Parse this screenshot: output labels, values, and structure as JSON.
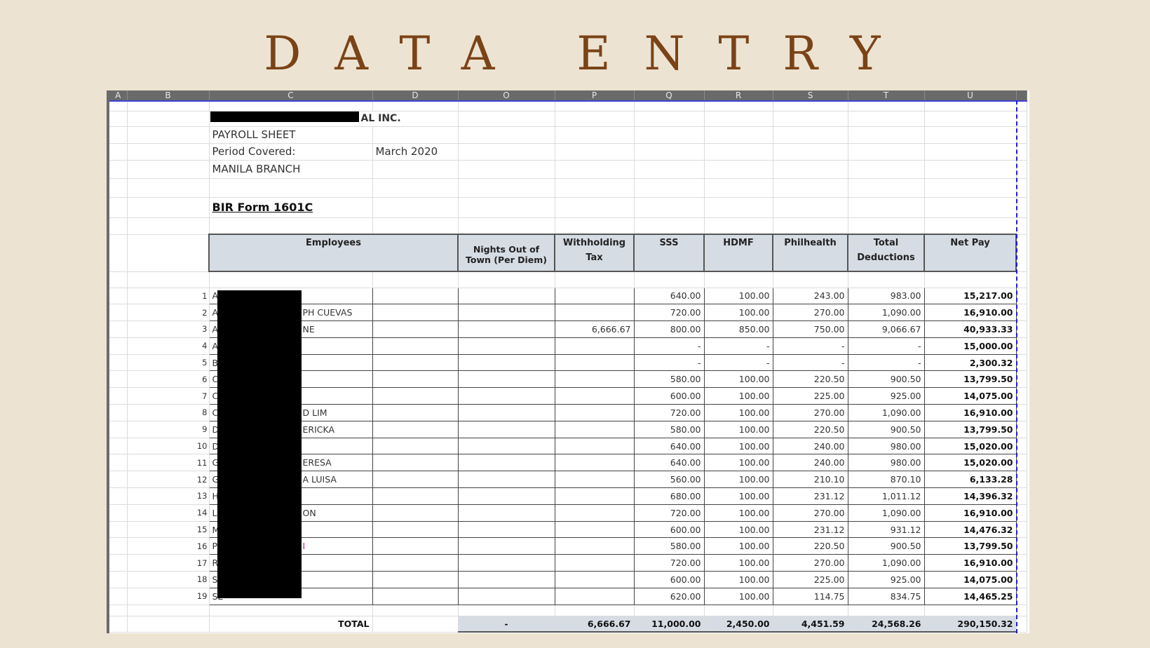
{
  "title": "DATA ENTRY",
  "columns": [
    "A",
    "B",
    "C",
    "D",
    "O",
    "P",
    "Q",
    "R",
    "S",
    "T",
    "U"
  ],
  "company_suffix": "AL INC.",
  "sheet_label": "PAYROLL SHEET",
  "period_label": "Period Covered:",
  "period_value": "March 2020",
  "branch": "MANILA BRANCH",
  "form": "BIR Form 1601C",
  "headers": {
    "employees": "Employees",
    "nights": "Nights Out of Town (Per Diem)",
    "wtax1": "Withholding",
    "wtax2": "Tax",
    "sss": "SSS",
    "hdmf": "HDMF",
    "philhealth": "Philhealth",
    "td1": "Total",
    "td2": "Deductions",
    "net": "Net Pay"
  },
  "rows": [
    {
      "n": "1",
      "first": "A",
      "last": "",
      "nights": "",
      "wtax": "",
      "sss": "640.00",
      "hdmf": "100.00",
      "phil": "243.00",
      "total": "983.00",
      "net": "15,217.00"
    },
    {
      "n": "2",
      "first": "A",
      "last": "PH CUEVAS",
      "nights": "",
      "wtax": "",
      "sss": "720.00",
      "hdmf": "100.00",
      "phil": "270.00",
      "total": "1,090.00",
      "net": "16,910.00"
    },
    {
      "n": "3",
      "first": "A",
      "last": "NE",
      "nights": "",
      "wtax": "6,666.67",
      "sss": "800.00",
      "hdmf": "850.00",
      "phil": "750.00",
      "total": "9,066.67",
      "net": "40,933.33"
    },
    {
      "n": "4",
      "first": "A",
      "last": "",
      "nights": "",
      "wtax": "",
      "sss": "-",
      "hdmf": "-",
      "phil": "-",
      "total": "-",
      "net": "15,000.00"
    },
    {
      "n": "5",
      "first": "B",
      "last": "",
      "nights": "",
      "wtax": "",
      "sss": "-",
      "hdmf": "-",
      "phil": "-",
      "total": "-",
      "net": "2,300.32"
    },
    {
      "n": "6",
      "first": "C",
      "last": "",
      "nights": "",
      "wtax": "",
      "sss": "580.00",
      "hdmf": "100.00",
      "phil": "220.50",
      "total": "900.50",
      "net": "13,799.50"
    },
    {
      "n": "7",
      "first": "C",
      "last": "",
      "nights": "",
      "wtax": "",
      "sss": "600.00",
      "hdmf": "100.00",
      "phil": "225.00",
      "total": "925.00",
      "net": "14,075.00"
    },
    {
      "n": "8",
      "first": "C",
      "last": "D LIM",
      "nights": "",
      "wtax": "",
      "sss": "720.00",
      "hdmf": "100.00",
      "phil": "270.00",
      "total": "1,090.00",
      "net": "16,910.00"
    },
    {
      "n": "9",
      "first": "D",
      "last": "ERICKA",
      "nights": "",
      "wtax": "",
      "sss": "580.00",
      "hdmf": "100.00",
      "phil": "220.50",
      "total": "900.50",
      "net": "13,799.50"
    },
    {
      "n": "10",
      "first": "D",
      "last": "",
      "nights": "",
      "wtax": "",
      "sss": "640.00",
      "hdmf": "100.00",
      "phil": "240.00",
      "total": "980.00",
      "net": "15,020.00"
    },
    {
      "n": "11",
      "first": "G",
      "last": "ERESA",
      "nights": "",
      "wtax": "",
      "sss": "640.00",
      "hdmf": "100.00",
      "phil": "240.00",
      "total": "980.00",
      "net": "15,020.00"
    },
    {
      "n": "12",
      "first": "G",
      "last": "A LUISA",
      "nights": "",
      "wtax": "",
      "sss": "560.00",
      "hdmf": "100.00",
      "phil": "210.10",
      "total": "870.10",
      "net": "6,133.28"
    },
    {
      "n": "13",
      "first": "H",
      "last": "",
      "nights": "",
      "wtax": "",
      "sss": "680.00",
      "hdmf": "100.00",
      "phil": "231.12",
      "total": "1,011.12",
      "net": "14,396.32"
    },
    {
      "n": "14",
      "first": "LI",
      "last": "ON",
      "nights": "",
      "wtax": "",
      "sss": "720.00",
      "hdmf": "100.00",
      "phil": "270.00",
      "total": "1,090.00",
      "net": "16,910.00"
    },
    {
      "n": "15",
      "first": "M",
      "last": "",
      "nights": "",
      "wtax": "",
      "sss": "600.00",
      "hdmf": "100.00",
      "phil": "231.12",
      "total": "931.12",
      "net": "14,476.32"
    },
    {
      "n": "16",
      "first": "P",
      "last": "I",
      "nights": "",
      "wtax": "",
      "sss": "580.00",
      "hdmf": "100.00",
      "phil": "220.50",
      "total": "900.50",
      "net": "13,799.50"
    },
    {
      "n": "17",
      "first": "R",
      "last": "",
      "nights": "",
      "wtax": "",
      "sss": "720.00",
      "hdmf": "100.00",
      "phil": "270.00",
      "total": "1,090.00",
      "net": "16,910.00"
    },
    {
      "n": "18",
      "first": "SA",
      "last": "",
      "nights": "",
      "wtax": "",
      "sss": "600.00",
      "hdmf": "100.00",
      "phil": "225.00",
      "total": "925.00",
      "net": "14,075.00"
    },
    {
      "n": "19",
      "first": "SE",
      "last": "",
      "nights": "",
      "wtax": "",
      "sss": "620.00",
      "hdmf": "100.00",
      "phil": "114.75",
      "total": "834.75",
      "net": "14,465.25"
    }
  ],
  "totals": {
    "label": "TOTAL",
    "nights": "-",
    "wtax": "6,666.67",
    "sss": "11,000.00",
    "hdmf": "2,450.00",
    "phil": "4,451.59",
    "total": "24,568.26",
    "net": "290,150.32"
  }
}
